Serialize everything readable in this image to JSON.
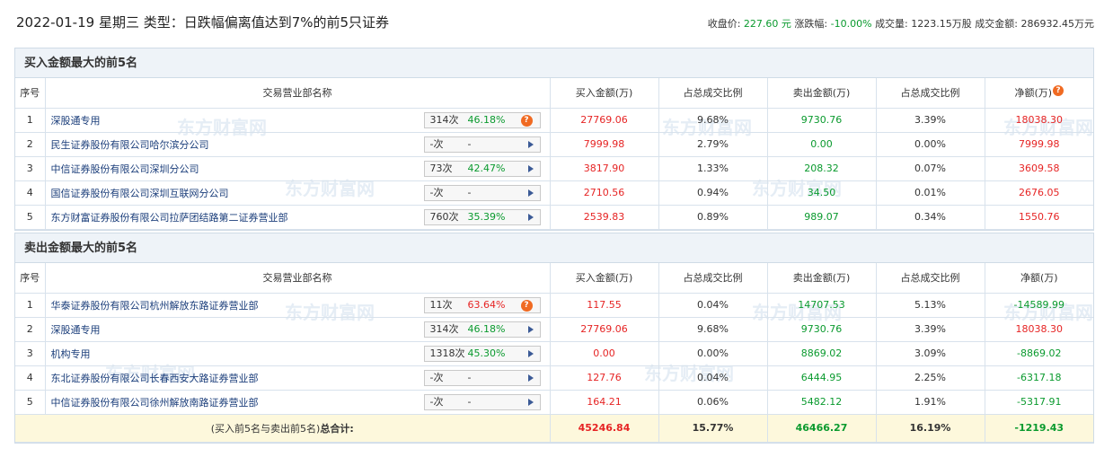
{
  "header": {
    "title": "2022-01-19 星期三 类型：日跌幅偏离值达到7%的前5只证券",
    "close_label": "收盘价:",
    "close_value": "227.60 元",
    "change_label": "涨跌幅:",
    "change_value": "-10.00%",
    "volume_label": "成交量:",
    "volume_value": "1223.15万股",
    "amount_label": "成交金额:",
    "amount_value": "286932.45万元"
  },
  "columns": {
    "idx": "序号",
    "name": "交易营业部名称",
    "buy": "买入金额(万)",
    "buy_ratio": "占总成交比例",
    "sell": "卖出金额(万)",
    "sell_ratio": "占总成交比例",
    "net": "净额(万)"
  },
  "watermark": "东方财富网",
  "buy_section": {
    "title": "买入金额最大的前5名",
    "rows": [
      {
        "idx": "1",
        "name": "深股通专用",
        "count": "314次",
        "pct": "46.18%",
        "pct_color": "green",
        "icon": "question",
        "buy": "27769.06",
        "buy_ratio": "9.68%",
        "sell": "9730.76",
        "sell_ratio": "3.39%",
        "net": "18038.30",
        "net_color": "red"
      },
      {
        "idx": "2",
        "name": "民生证券股份有限公司哈尔滨分公司",
        "count": "-次",
        "pct": "-",
        "pct_color": "dark",
        "icon": "arrow",
        "buy": "7999.98",
        "buy_ratio": "2.79%",
        "sell": "0.00",
        "sell_ratio": "0.00%",
        "net": "7999.98",
        "net_color": "red"
      },
      {
        "idx": "3",
        "name": "中信证券股份有限公司深圳分公司",
        "count": "73次",
        "pct": "42.47%",
        "pct_color": "green",
        "icon": "arrow",
        "buy": "3817.90",
        "buy_ratio": "1.33%",
        "sell": "208.32",
        "sell_ratio": "0.07%",
        "net": "3609.58",
        "net_color": "red"
      },
      {
        "idx": "4",
        "name": "国信证券股份有限公司深圳互联网分公司",
        "count": "-次",
        "pct": "-",
        "pct_color": "dark",
        "icon": "arrow",
        "buy": "2710.56",
        "buy_ratio": "0.94%",
        "sell": "34.50",
        "sell_ratio": "0.01%",
        "net": "2676.05",
        "net_color": "red"
      },
      {
        "idx": "5",
        "name": "东方财富证券股份有限公司拉萨团结路第二证券营业部",
        "count": "760次",
        "pct": "35.39%",
        "pct_color": "green",
        "icon": "arrow",
        "buy": "2539.83",
        "buy_ratio": "0.89%",
        "sell": "989.07",
        "sell_ratio": "0.34%",
        "net": "1550.76",
        "net_color": "red"
      }
    ]
  },
  "sell_section": {
    "title": "卖出金额最大的前5名",
    "rows": [
      {
        "idx": "1",
        "name": "华泰证券股份有限公司杭州解放东路证券营业部",
        "count": "11次",
        "pct": "63.64%",
        "pct_color": "red",
        "icon": "question",
        "buy": "117.55",
        "buy_ratio": "0.04%",
        "sell": "14707.53",
        "sell_ratio": "5.13%",
        "net": "-14589.99",
        "net_color": "green"
      },
      {
        "idx": "2",
        "name": "深股通专用",
        "count": "314次",
        "pct": "46.18%",
        "pct_color": "green",
        "icon": "arrow",
        "buy": "27769.06",
        "buy_ratio": "9.68%",
        "sell": "9730.76",
        "sell_ratio": "3.39%",
        "net": "18038.30",
        "net_color": "red"
      },
      {
        "idx": "3",
        "name": "机构专用",
        "count": "1318次",
        "pct": "45.30%",
        "pct_color": "green",
        "icon": "arrow",
        "buy": "0.00",
        "buy_ratio": "0.00%",
        "sell": "8869.02",
        "sell_ratio": "3.09%",
        "net": "-8869.02",
        "net_color": "green"
      },
      {
        "idx": "4",
        "name": "东北证券股份有限公司长春西安大路证券营业部",
        "count": "-次",
        "pct": "-",
        "pct_color": "dark",
        "icon": "arrow",
        "buy": "127.76",
        "buy_ratio": "0.04%",
        "sell": "6444.95",
        "sell_ratio": "2.25%",
        "net": "-6317.18",
        "net_color": "green"
      },
      {
        "idx": "5",
        "name": "中信证券股份有限公司徐州解放南路证券营业部",
        "count": "-次",
        "pct": "-",
        "pct_color": "dark",
        "icon": "arrow",
        "buy": "164.21",
        "buy_ratio": "0.06%",
        "sell": "5482.12",
        "sell_ratio": "1.91%",
        "net": "-5317.91",
        "net_color": "green"
      }
    ]
  },
  "total": {
    "label_prefix": "(买入前5名与卖出前5名)",
    "label_bold": "总合计:",
    "buy": "45246.84",
    "buy_ratio": "15.77%",
    "sell": "46466.27",
    "sell_ratio": "16.19%",
    "net": "-1219.43"
  }
}
